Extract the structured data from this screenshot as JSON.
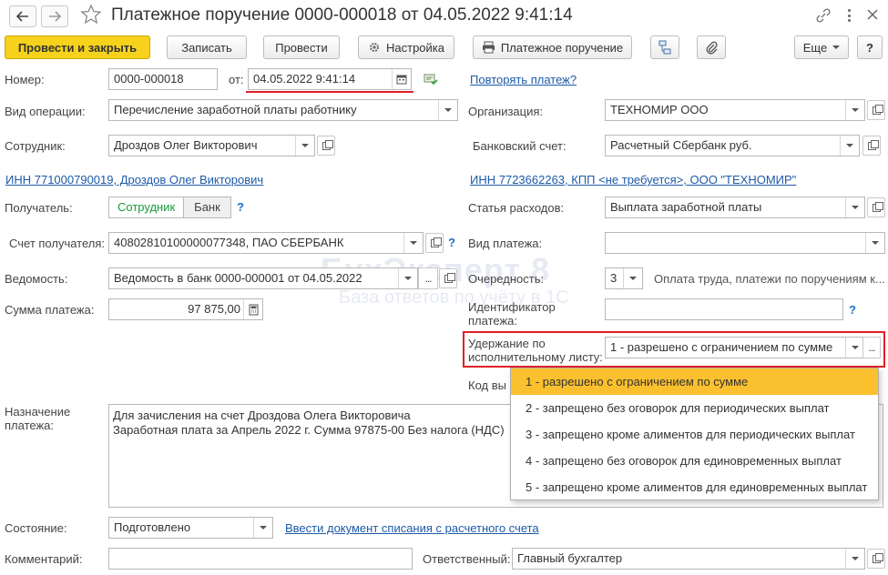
{
  "window": {
    "title": "Платежное поручение 0000-000018 от 04.05.2022 9:41:14"
  },
  "toolbar": {
    "post_close": "Провести и закрыть",
    "save": "Записать",
    "post": "Провести",
    "settings": "Настройка",
    "print_label": "Платежное поручение",
    "more": "Еще",
    "help": "?"
  },
  "form": {
    "number_label": "Номер:",
    "number_value": "0000-000018",
    "date_label": "от:",
    "date_value": "04.05.2022  9:41:14",
    "repeat_link": "Повторять платеж?",
    "operation_label": "Вид операции:",
    "operation_value": "Перечисление заработной платы работнику",
    "org_label": "Организация:",
    "org_value": "ТЕХНОМИР ООО",
    "employee_label": "Сотрудник:",
    "employee_value": "Дроздов Олег Викторович",
    "bank_account_label": "Банковский счет:",
    "bank_account_value": "Расчетный Сбербанк руб.",
    "employee_inn_link": "ИНН 771000790019, Дроздов Олег Викторович",
    "org_inn_link": "ИНН 7723662263, КПП <не требуется>, ООО \"ТЕХНОМИР\"",
    "recipient_label": "Получатель:",
    "recipient_opt1": "Сотрудник",
    "recipient_opt2": "Банк",
    "expense_label": "Статья расходов:",
    "expense_value": "Выплата заработной платы",
    "recipient_account_label": "Счет получателя:",
    "recipient_account_value": "40802810100000077348, ПАО СБЕРБАНК",
    "payment_type_label": "Вид платежа:",
    "payment_type_value": "",
    "statement_label": "Ведомость:",
    "statement_value": "Ведомость в банк 0000-000001 от 04.05.2022",
    "priority_label": "Очередность:",
    "priority_value": "3",
    "priority_desc": "Оплата труда, платежи по поручениям к...",
    "amount_label": "Сумма платежа:",
    "amount_value": "97 875,00",
    "payment_id_label_1": "Идентификатор",
    "payment_id_label_2": "платежа:",
    "payment_id_value": "",
    "withhold_label_1": "Удержание по",
    "withhold_label_2": "исполнительному листу:",
    "withhold_value": "1 - разрешено с ограничением по сумме",
    "code_label": "Код вы",
    "purpose_label_1": "Назначение",
    "purpose_label_2": "платежа:",
    "purpose_line1": "Для зачисления на счет Дроздова Олега Викторовича",
    "purpose_line2": "Заработная плата за Апрель 2022 г. Сумма 97875-00 Без налога (НДС)",
    "state_label": "Состояние:",
    "state_value": "Подготовлено",
    "writeoff_link": "Ввести документ списания с расчетного счета",
    "comment_label": "Комментарий:",
    "comment_value": "",
    "responsible_label": "Ответственный:",
    "responsible_value": "Главный бухгалтер"
  },
  "dropdown": {
    "items": [
      "1 - разрешено с ограничением по сумме",
      "2 - запрещено без оговорок для периодических выплат",
      "3 - запрещено кроме алиментов для периодических выплат",
      "4 - запрещено без оговорок для единовременных выплат",
      "5 - запрещено кроме алиментов для единовременных выплат"
    ],
    "selected_index": 0
  },
  "watermark": {
    "line1": "БухЭксперт 8",
    "line2": "База ответов по учёту в 1С"
  },
  "colors": {
    "primary_button": "#f6d21c",
    "link": "#1d5aa8",
    "highlight": "#fbc02d",
    "red_outline": "#e01f26",
    "active_toggle": "#1a9a3a"
  }
}
